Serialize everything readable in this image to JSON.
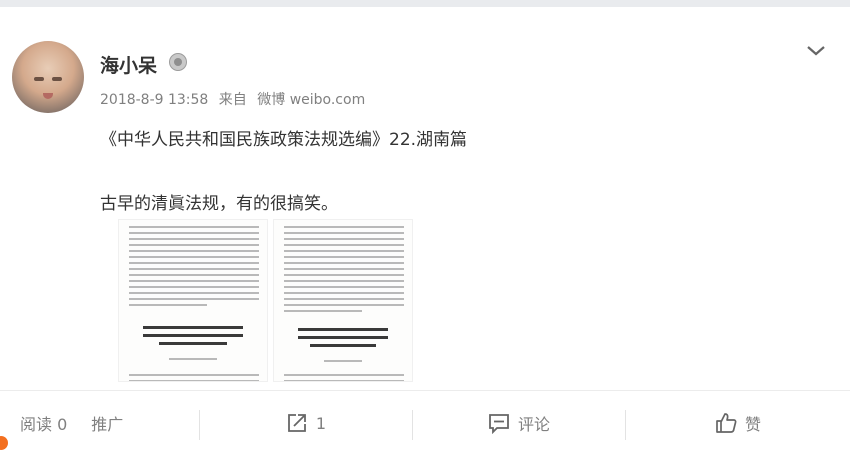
{
  "post": {
    "username": "海小呆",
    "date": "2018-8-9 13:58",
    "source_prefix": "来自",
    "source": "微博 weibo.com",
    "line1": "《中华人民共和国民族政策法规选编》22.湖南篇",
    "line2": "古早的清眞法规，有的很搞笑。"
  },
  "footer": {
    "reads_label": "阅读",
    "reads_count": "0",
    "promote_label": "推广",
    "repost_count": "1",
    "comment_label": "评论",
    "like_label": "赞"
  },
  "icons": {
    "badge": "member-badge-icon",
    "menu": "chevron-down-icon",
    "repost": "repost-icon",
    "comment": "comment-icon",
    "like": "thumbs-up-icon"
  }
}
